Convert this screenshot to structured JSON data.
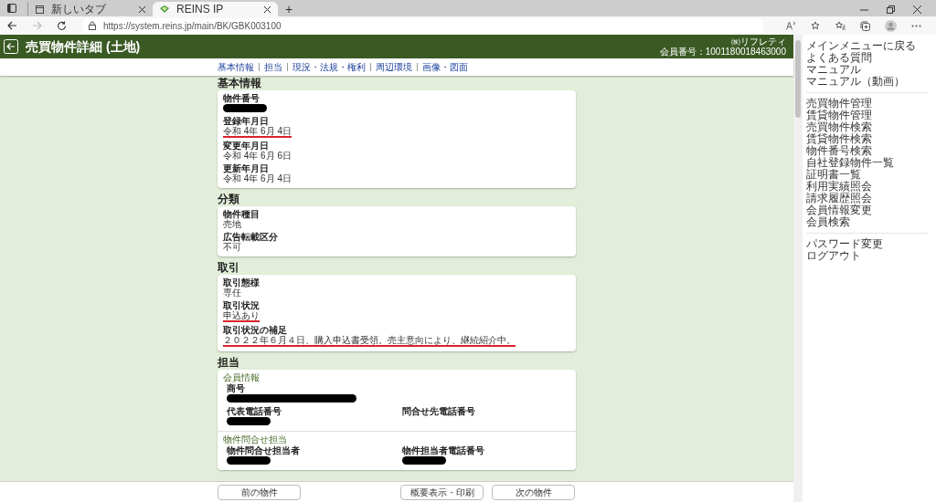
{
  "browser": {
    "tabs": [
      {
        "label": "新しいタブ",
        "selected": false
      },
      {
        "label": "REINS IP",
        "selected": true
      }
    ],
    "address": "https://system.reins.jp/main/BK/GBK003100",
    "new_tab_symbol": "+"
  },
  "header": {
    "title": "売買物件詳細 (土地)",
    "company": "㈱リフレティ",
    "member_number": "会員番号：1001180018463000"
  },
  "nav_links": [
    "基本情報",
    "担当",
    "現況・法規・権利",
    "周辺環境",
    "画像・図面"
  ],
  "sections": [
    {
      "title": "基本情報",
      "groups": [
        {
          "fields": [
            {
              "label": "物件番号",
              "kind": "redacted_short",
              "underlined": false
            },
            {
              "label": "登録年月日",
              "kind": "text",
              "value": "令和 4年 6月 4日",
              "underlined": true
            },
            {
              "label": "変更年月日",
              "kind": "text",
              "value": "令和 4年 6月 6日",
              "underlined": false
            },
            {
              "label": "更新年月日",
              "kind": "text",
              "value": "令和 4年 6月 4日",
              "underlined": false
            }
          ]
        }
      ]
    },
    {
      "title": "分類",
      "groups": [
        {
          "fields": [
            {
              "label": "物件種目",
              "kind": "text",
              "value": "売地",
              "underlined": false
            },
            {
              "label": "広告転載区分",
              "kind": "text",
              "value": "不可",
              "underlined": false
            }
          ]
        }
      ]
    },
    {
      "title": "取引",
      "groups": [
        {
          "fields": [
            {
              "label": "取引態様",
              "kind": "text",
              "value": "専任",
              "underlined": false
            },
            {
              "label": "取引状況",
              "kind": "text",
              "value": "申込あり",
              "underlined": true
            },
            {
              "label": "取引状況の補足",
              "kind": "text",
              "value": "２０２２年６月４日、購入申込書受領。売主意向により、継続紹介中。",
              "underlined": true
            }
          ]
        }
      ]
    },
    {
      "title": "担当",
      "groups": [
        {
          "subtitle": "会員情報",
          "fields": [
            {
              "label": "商号",
              "kind": "redacted_long",
              "underlined": false
            },
            {
              "label": "代表電話番号",
              "kind": "redacted_short",
              "underlined": false
            },
            {
              "label": "問合せ先電話番号",
              "kind": "empty"
            }
          ]
        },
        {
          "subtitle": "物件問合せ担当",
          "fields": [
            {
              "label": "物件問合せ担当者",
              "kind": "redacted_short",
              "underlined": false
            },
            {
              "label": "物件担当者電話番号",
              "kind": "redacted_short",
              "underlined": false
            }
          ]
        }
      ]
    }
  ],
  "footer_buttons": [
    "前の物件",
    "概要表示・印刷",
    "次の物件"
  ],
  "side_menu": [
    [
      "メインメニューに戻る",
      "よくある質問",
      "マニュアル",
      "マニュアル（動画）"
    ],
    [
      "売買物件管理",
      "賃貸物件管理",
      "売買物件検索",
      "賃貸物件検索",
      "物件番号検索",
      "自社登録物件一覧",
      "証明書一覧",
      "利用実績照会",
      "請求履歴照会",
      "会員情報変更",
      "会員検索"
    ],
    [
      "パスワード変更",
      "ログアウト"
    ]
  ]
}
